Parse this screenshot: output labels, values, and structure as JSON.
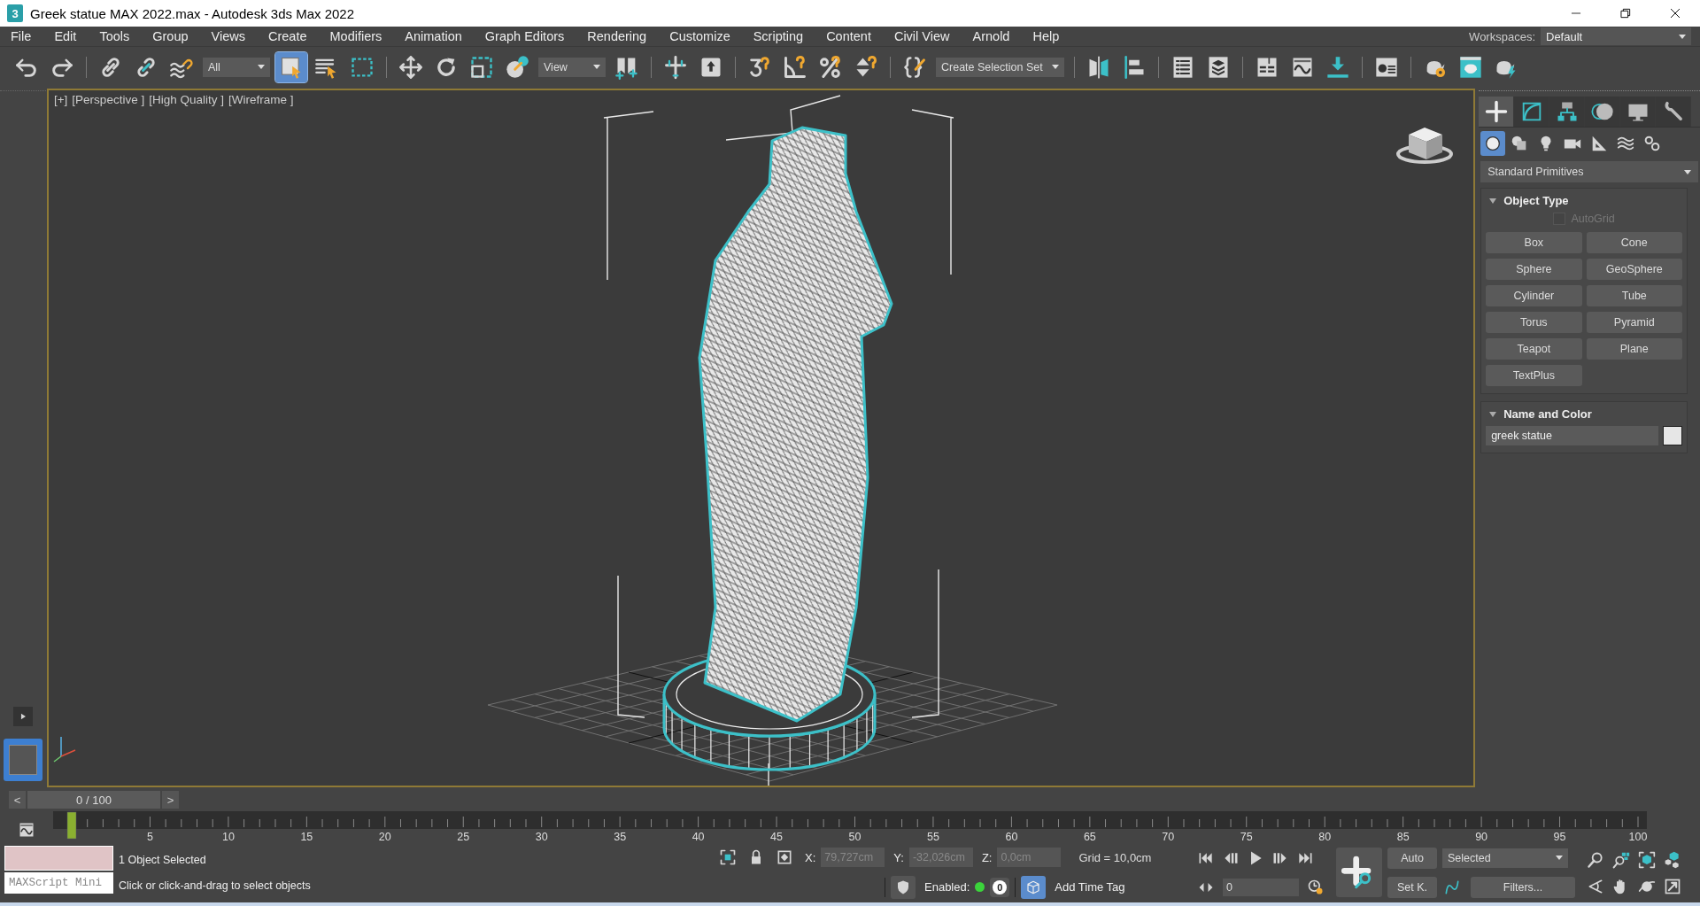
{
  "window": {
    "logo": "3",
    "title": "Greek statue MAX 2022.max - Autodesk 3ds Max 2022"
  },
  "menu": [
    "File",
    "Edit",
    "Tools",
    "Group",
    "Views",
    "Create",
    "Modifiers",
    "Animation",
    "Graph Editors",
    "Rendering",
    "Customize",
    "Scripting",
    "Content",
    "Civil View",
    "Arnold",
    "Help"
  ],
  "workspaces": {
    "label": "Workspaces:",
    "value": "Default"
  },
  "toolbar": [
    [
      {
        "kind": "undo",
        "selected": false
      },
      {
        "kind": "redo",
        "selected": false
      }
    ],
    [
      {
        "kind": "link",
        "selected": false
      },
      {
        "kind": "unlink",
        "selected": false
      },
      {
        "kind": "bind",
        "selected": false
      },
      {
        "kind": "dropdown",
        "label": "All"
      },
      {
        "kind": "select",
        "selected": true
      },
      {
        "kind": "select-list",
        "selected": false
      },
      {
        "kind": "region",
        "selected": false
      }
    ],
    [
      {
        "kind": "move",
        "selected": false
      },
      {
        "kind": "rotate",
        "selected": false
      },
      {
        "kind": "scale",
        "selected": false
      },
      {
        "kind": "placement",
        "selected": false
      },
      {
        "kind": "dropdown",
        "label": "View"
      },
      {
        "kind": "pivot",
        "selected": false
      }
    ],
    [
      {
        "kind": "manipulate",
        "selected": false
      },
      {
        "kind": "keyboard",
        "selected": false
      }
    ],
    [
      {
        "kind": "snap",
        "selected": false
      },
      {
        "kind": "angle-snap",
        "selected": false
      },
      {
        "kind": "percent-snap",
        "selected": false
      },
      {
        "kind": "spinner-snap",
        "selected": false
      }
    ],
    [
      {
        "kind": "braces",
        "selected": false
      },
      {
        "kind": "dropdown",
        "label": "Create Selection Set"
      }
    ],
    [
      {
        "kind": "mirror",
        "selected": false
      },
      {
        "kind": "align",
        "selected": false
      }
    ],
    [
      {
        "kind": "list",
        "selected": false
      },
      {
        "kind": "layers",
        "selected": false
      }
    ],
    [
      {
        "kind": "ribbon",
        "selected": false
      },
      {
        "kind": "curve",
        "selected": false
      },
      {
        "kind": "dope",
        "selected": false
      }
    ],
    [
      {
        "kind": "material",
        "selected": false
      }
    ],
    [
      {
        "kind": "render-setup",
        "selected": false
      },
      {
        "kind": "render-frame",
        "selected": false
      },
      {
        "kind": "render",
        "selected": false
      }
    ]
  ],
  "viewport": {
    "active": true,
    "labels": [
      "[+]",
      "[Perspective ]",
      "[High Quality ]",
      "[Wireframe ]"
    ]
  },
  "command_panel": {
    "tabs": [
      {
        "kind": "create",
        "selected": true
      },
      {
        "kind": "modify",
        "selected": false
      },
      {
        "kind": "hierarchy",
        "selected": false
      },
      {
        "kind": "motion",
        "selected": false
      },
      {
        "kind": "display",
        "selected": false
      },
      {
        "kind": "utilities",
        "selected": false
      }
    ],
    "categories": [
      {
        "kind": "geometry",
        "selected": true
      },
      {
        "kind": "shapes",
        "selected": false
      },
      {
        "kind": "lights",
        "selected": false
      },
      {
        "kind": "cameras",
        "selected": false
      },
      {
        "kind": "helpers",
        "selected": false
      },
      {
        "kind": "spacewarps",
        "selected": false
      },
      {
        "kind": "systems",
        "selected": false
      }
    ],
    "type_dropdown": "Standard Primitives",
    "object_type": {
      "title": "Object Type",
      "expanded": true,
      "autogrid": {
        "label": "AutoGrid",
        "checked": false,
        "disabled": true
      },
      "buttons": [
        "Box",
        "Cone",
        "Sphere",
        "GeoSphere",
        "Cylinder",
        "Tube",
        "Torus",
        "Pyramid",
        "Teapot",
        "Plane",
        "TextPlus"
      ]
    },
    "name_and_color": {
      "title": "Name and Color",
      "expanded": true,
      "name": "greek statue"
    }
  },
  "time_slider": {
    "prev": "<",
    "position": "0 / 100",
    "next": ">",
    "level": 0
  },
  "track_bar": {
    "ticks": [
      "5",
      "10",
      "15",
      "20",
      "25",
      "30",
      "35",
      "40",
      "45",
      "50",
      "55",
      "60",
      "65",
      "70",
      "75",
      "80",
      "85",
      "90",
      "95",
      "100"
    ]
  },
  "status": {
    "listener": {
      "placeholder": "MAXScript Mini"
    },
    "selection": "1 Object Selected",
    "prompt": "Click or click-and-drag to select objects",
    "coords": [
      {
        "label": "X:",
        "value": "79,727cm"
      },
      {
        "label": "Y:",
        "value": "-32,026cm"
      },
      {
        "label": "Z:",
        "value": "0,0cm"
      }
    ],
    "grid": "Grid = 10,0cm",
    "enabled_label": "Enabled:",
    "enabled": true,
    "tag_count": "0",
    "add_time_tag": "Add Time Tag",
    "frame": "0",
    "auto_key": "Auto",
    "set_key": "Set K.",
    "key_filter": "Selected",
    "filters": "Filters..."
  }
}
